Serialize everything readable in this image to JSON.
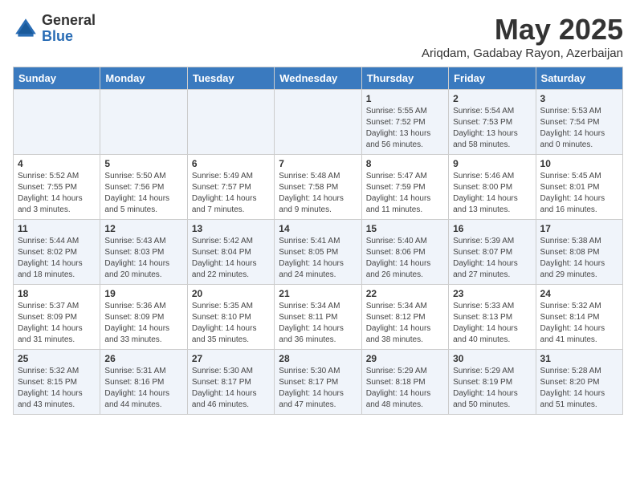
{
  "logo": {
    "general": "General",
    "blue": "Blue"
  },
  "title": {
    "month_year": "May 2025",
    "location": "Ariqdam, Gadabay Rayon, Azerbaijan"
  },
  "days_of_week": [
    "Sunday",
    "Monday",
    "Tuesday",
    "Wednesday",
    "Thursday",
    "Friday",
    "Saturday"
  ],
  "weeks": [
    [
      {
        "day": "",
        "info": ""
      },
      {
        "day": "",
        "info": ""
      },
      {
        "day": "",
        "info": ""
      },
      {
        "day": "",
        "info": ""
      },
      {
        "day": "1",
        "info": "Sunrise: 5:55 AM\nSunset: 7:52 PM\nDaylight: 13 hours\nand 56 minutes."
      },
      {
        "day": "2",
        "info": "Sunrise: 5:54 AM\nSunset: 7:53 PM\nDaylight: 13 hours\nand 58 minutes."
      },
      {
        "day": "3",
        "info": "Sunrise: 5:53 AM\nSunset: 7:54 PM\nDaylight: 14 hours\nand 0 minutes."
      }
    ],
    [
      {
        "day": "4",
        "info": "Sunrise: 5:52 AM\nSunset: 7:55 PM\nDaylight: 14 hours\nand 3 minutes."
      },
      {
        "day": "5",
        "info": "Sunrise: 5:50 AM\nSunset: 7:56 PM\nDaylight: 14 hours\nand 5 minutes."
      },
      {
        "day": "6",
        "info": "Sunrise: 5:49 AM\nSunset: 7:57 PM\nDaylight: 14 hours\nand 7 minutes."
      },
      {
        "day": "7",
        "info": "Sunrise: 5:48 AM\nSunset: 7:58 PM\nDaylight: 14 hours\nand 9 minutes."
      },
      {
        "day": "8",
        "info": "Sunrise: 5:47 AM\nSunset: 7:59 PM\nDaylight: 14 hours\nand 11 minutes."
      },
      {
        "day": "9",
        "info": "Sunrise: 5:46 AM\nSunset: 8:00 PM\nDaylight: 14 hours\nand 13 minutes."
      },
      {
        "day": "10",
        "info": "Sunrise: 5:45 AM\nSunset: 8:01 PM\nDaylight: 14 hours\nand 16 minutes."
      }
    ],
    [
      {
        "day": "11",
        "info": "Sunrise: 5:44 AM\nSunset: 8:02 PM\nDaylight: 14 hours\nand 18 minutes."
      },
      {
        "day": "12",
        "info": "Sunrise: 5:43 AM\nSunset: 8:03 PM\nDaylight: 14 hours\nand 20 minutes."
      },
      {
        "day": "13",
        "info": "Sunrise: 5:42 AM\nSunset: 8:04 PM\nDaylight: 14 hours\nand 22 minutes."
      },
      {
        "day": "14",
        "info": "Sunrise: 5:41 AM\nSunset: 8:05 PM\nDaylight: 14 hours\nand 24 minutes."
      },
      {
        "day": "15",
        "info": "Sunrise: 5:40 AM\nSunset: 8:06 PM\nDaylight: 14 hours\nand 26 minutes."
      },
      {
        "day": "16",
        "info": "Sunrise: 5:39 AM\nSunset: 8:07 PM\nDaylight: 14 hours\nand 27 minutes."
      },
      {
        "day": "17",
        "info": "Sunrise: 5:38 AM\nSunset: 8:08 PM\nDaylight: 14 hours\nand 29 minutes."
      }
    ],
    [
      {
        "day": "18",
        "info": "Sunrise: 5:37 AM\nSunset: 8:09 PM\nDaylight: 14 hours\nand 31 minutes."
      },
      {
        "day": "19",
        "info": "Sunrise: 5:36 AM\nSunset: 8:09 PM\nDaylight: 14 hours\nand 33 minutes."
      },
      {
        "day": "20",
        "info": "Sunrise: 5:35 AM\nSunset: 8:10 PM\nDaylight: 14 hours\nand 35 minutes."
      },
      {
        "day": "21",
        "info": "Sunrise: 5:34 AM\nSunset: 8:11 PM\nDaylight: 14 hours\nand 36 minutes."
      },
      {
        "day": "22",
        "info": "Sunrise: 5:34 AM\nSunset: 8:12 PM\nDaylight: 14 hours\nand 38 minutes."
      },
      {
        "day": "23",
        "info": "Sunrise: 5:33 AM\nSunset: 8:13 PM\nDaylight: 14 hours\nand 40 minutes."
      },
      {
        "day": "24",
        "info": "Sunrise: 5:32 AM\nSunset: 8:14 PM\nDaylight: 14 hours\nand 41 minutes."
      }
    ],
    [
      {
        "day": "25",
        "info": "Sunrise: 5:32 AM\nSunset: 8:15 PM\nDaylight: 14 hours\nand 43 minutes."
      },
      {
        "day": "26",
        "info": "Sunrise: 5:31 AM\nSunset: 8:16 PM\nDaylight: 14 hours\nand 44 minutes."
      },
      {
        "day": "27",
        "info": "Sunrise: 5:30 AM\nSunset: 8:17 PM\nDaylight: 14 hours\nand 46 minutes."
      },
      {
        "day": "28",
        "info": "Sunrise: 5:30 AM\nSunset: 8:17 PM\nDaylight: 14 hours\nand 47 minutes."
      },
      {
        "day": "29",
        "info": "Sunrise: 5:29 AM\nSunset: 8:18 PM\nDaylight: 14 hours\nand 48 minutes."
      },
      {
        "day": "30",
        "info": "Sunrise: 5:29 AM\nSunset: 8:19 PM\nDaylight: 14 hours\nand 50 minutes."
      },
      {
        "day": "31",
        "info": "Sunrise: 5:28 AM\nSunset: 8:20 PM\nDaylight: 14 hours\nand 51 minutes."
      }
    ]
  ]
}
